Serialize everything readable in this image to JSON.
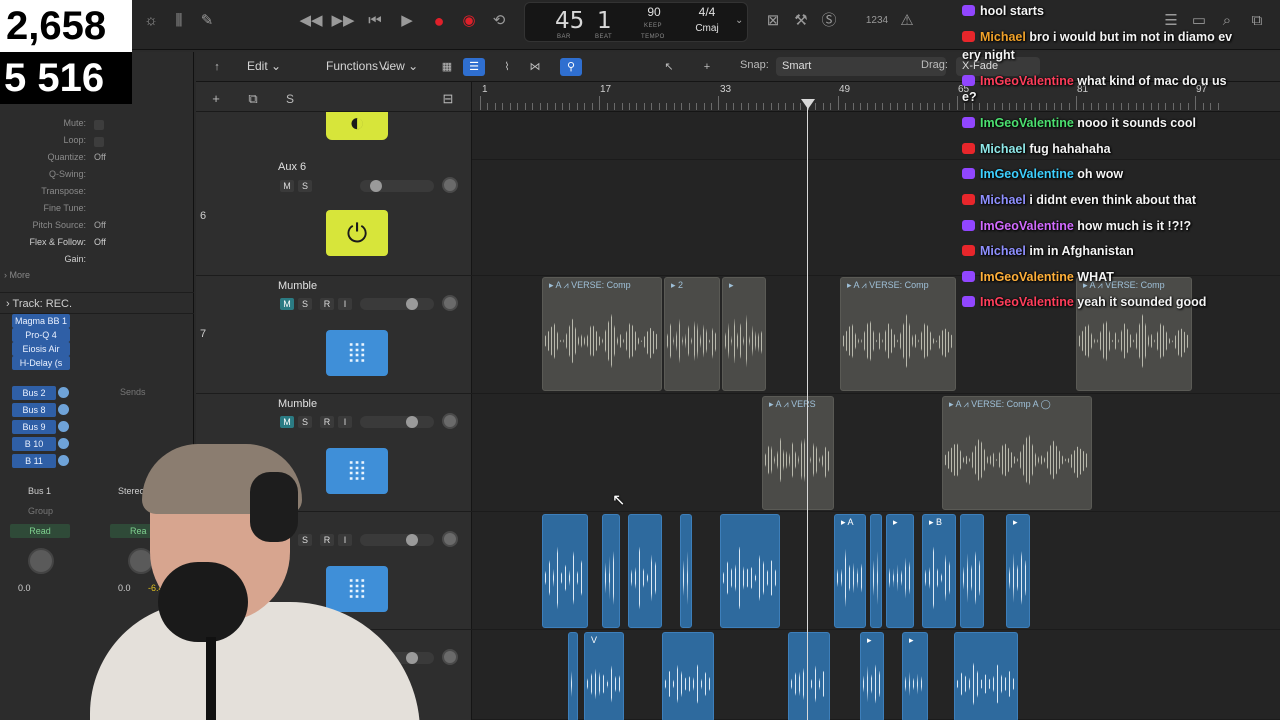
{
  "counters": {
    "top": "2,658",
    "bottom": "5 516"
  },
  "control": {
    "lcd": {
      "bar": "45",
      "beat": "1",
      "bar_cap": "BAR",
      "beat_cap": "BEAT",
      "tempo": "90",
      "keep": "KEEP",
      "tempo_cap": "TEMPO",
      "sig": "4/4",
      "key": "Cmaj"
    },
    "count_in": "1234"
  },
  "inspector": {
    "rows": [
      {
        "label": "Mute:",
        "value": ""
      },
      {
        "label": "Loop:",
        "value": ""
      },
      {
        "label": "Quantize:",
        "value": "Off"
      },
      {
        "label": "Q-Swing:",
        "value": ""
      },
      {
        "label": "Transpose:",
        "value": ""
      },
      {
        "label": "Fine Tune:",
        "value": ""
      },
      {
        "label": "Pitch Source:",
        "value": "Off"
      },
      {
        "label": "Flex & Follow:",
        "value": "Off"
      },
      {
        "label": "Gain:",
        "value": ""
      }
    ],
    "more": "More",
    "track_label": "Track:",
    "track_value": "REC.",
    "plugins": [
      "Magma BB 1",
      "Pro-Q 4",
      "Eiosis Air",
      "H-Delay (s"
    ],
    "buses": [
      "Bus 2",
      "Bus 8",
      "Bus 9",
      "B 10",
      "B 11"
    ],
    "sends": "Sends",
    "strip": {
      "output1": "Bus 1",
      "output2": "Stereo",
      "group": "Group",
      "read1": "Read",
      "read2": "Rea",
      "vol1": "0.0",
      "vol2": "0.0",
      "vol2b": "-6.4"
    }
  },
  "toolbar": {
    "edit": "Edit",
    "functions": "Functions",
    "view": "View",
    "snap_label": "Snap:",
    "snap_value": "Smart",
    "drag_label": "Drag:",
    "drag_value": "X-Fade"
  },
  "ruler": {
    "bars": [
      "1",
      "17",
      "33",
      "49",
      "65",
      "81",
      "97"
    ]
  },
  "tracks": [
    {
      "num": "6",
      "name": "Aux 6"
    },
    {
      "num": "7",
      "name": "Mumble"
    },
    {
      "num": "",
      "name": "Mumble"
    }
  ],
  "regions": {
    "r1": "VERSE: Comp",
    "r2": "2",
    "r3": "",
    "r4": "VERSE: Comp",
    "r5": "VERSE: Comp",
    "r6": "VERS",
    "r7": "VERSE: Comp A",
    "b1": "A",
    "b2": "",
    "b3": "B",
    "b4": "",
    "v1": "V"
  },
  "chat": [
    {
      "platform": "tw",
      "user": "",
      "ucls": "",
      "msg": "hool starts"
    },
    {
      "platform": "yt",
      "user": "Michael",
      "ucls": "u-michael1",
      "msg": "bro i would but im not in diamo ev"
    },
    {
      "platform": "",
      "user": "",
      "ucls": "",
      "msg": "ery night"
    },
    {
      "platform": "tw",
      "user": "ImGeoValentine",
      "ucls": "u-geo1",
      "msg": "what kind of mac do u us"
    },
    {
      "platform": "",
      "user": "",
      "ucls": "",
      "msg": "e?"
    },
    {
      "platform": "tw",
      "user": "ImGeoValentine",
      "ucls": "u-geo2",
      "msg": "nooo it sounds cool"
    },
    {
      "platform": "yt",
      "user": "Michael",
      "ucls": "u-michael2",
      "msg": "fug hahahaha"
    },
    {
      "platform": "tw",
      "user": "ImGeoValentine",
      "ucls": "u-geo3",
      "msg": "oh wow"
    },
    {
      "platform": "yt",
      "user": "Michael",
      "ucls": "u-michael3",
      "msg": "i didnt even think about that"
    },
    {
      "platform": "tw",
      "user": "ImGeoValentine",
      "ucls": "u-geo4",
      "msg": "how much is it !?!?"
    },
    {
      "platform": "yt",
      "user": "Michael",
      "ucls": "u-michael3",
      "msg": "im in Afghanistan"
    },
    {
      "platform": "tw",
      "user": "ImGeoValentine",
      "ucls": "u-geo5",
      "msg": "WHAT"
    },
    {
      "platform": "tw",
      "user": "ImGeoValentine",
      "ucls": "u-geo1",
      "msg": "yeah it sounded good"
    }
  ]
}
